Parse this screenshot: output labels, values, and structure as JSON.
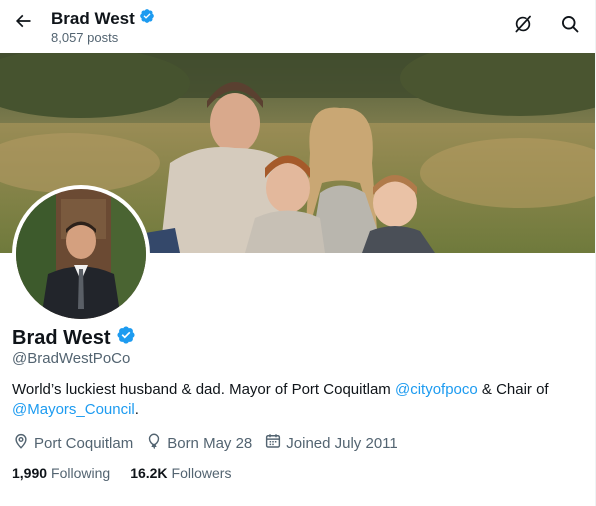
{
  "header": {
    "name": "Brad West",
    "posts_count": "8,057 posts"
  },
  "profile": {
    "display_name": "Brad West",
    "handle": "@BradWestPoCo",
    "bio": {
      "part1": "World’s luckiest husband & dad. Mayor of Port Coquitlam ",
      "mention1": "@cityofpoco",
      "part2": " & Chair of ",
      "mention2": "@Mayors_Council",
      "part3": "."
    },
    "location": "Port Coquitlam",
    "birthday": "Born May 28",
    "joined": "Joined July 2011",
    "following_count": "1,990",
    "following_label": "Following",
    "followers_count": "16.2K",
    "followers_label": "Followers"
  },
  "icons": {
    "back": "arrow-left-icon",
    "grok": "grok-icon",
    "search": "search-icon",
    "verified": "verified-badge-icon",
    "location": "location-pin-icon",
    "birthday": "balloon-icon",
    "calendar": "calendar-icon"
  },
  "colors": {
    "accent": "#1d9bf0",
    "text_primary": "#0f1419",
    "text_secondary": "#536471"
  }
}
